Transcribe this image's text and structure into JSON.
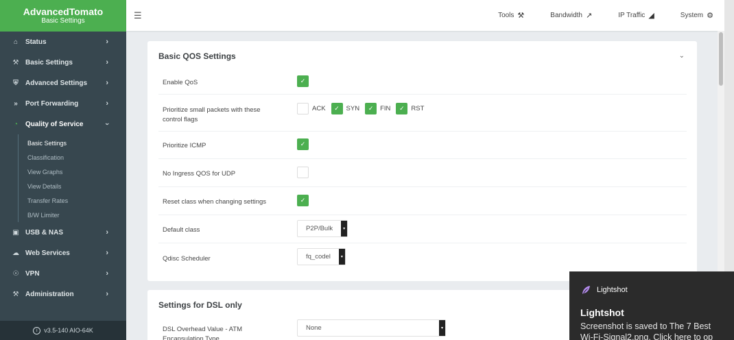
{
  "brand": {
    "title": "AdvancedTomato",
    "subtitle": "Basic Settings"
  },
  "sidebar": {
    "items": [
      {
        "label": "Status",
        "icon": "home-icon"
      },
      {
        "label": "Basic Settings",
        "icon": "wrench-icon"
      },
      {
        "label": "Advanced Settings",
        "icon": "shield-icon"
      },
      {
        "label": "Port Forwarding",
        "icon": "fast-forward-icon"
      },
      {
        "label": "Quality of Service",
        "icon": "gauge-icon"
      },
      {
        "label": "USB & NAS",
        "icon": "drive-icon"
      },
      {
        "label": "Web Services",
        "icon": "cloud-icon"
      },
      {
        "label": "VPN",
        "icon": "globe-icon"
      },
      {
        "label": "Administration",
        "icon": "wrench-icon"
      }
    ],
    "qos_subitems": [
      "Basic Settings",
      "Classification",
      "View Graphs",
      "View Details",
      "Transfer Rates",
      "B/W Limiter"
    ],
    "version": "v3.5-140 AIO-64K"
  },
  "topbar": {
    "items": [
      {
        "label": "Tools",
        "icon": "tools-icon"
      },
      {
        "label": "Bandwidth",
        "icon": "chart-line-icon"
      },
      {
        "label": "IP Traffic",
        "icon": "area-chart-icon"
      },
      {
        "label": "System",
        "icon": "gear-icon"
      }
    ]
  },
  "qos": {
    "title": "Basic QOS Settings",
    "enable_qos": {
      "label": "Enable QoS",
      "checked": true
    },
    "prioritize_flags": {
      "label": "Prioritize small packets with these control flags",
      "flags": [
        {
          "label": "ACK",
          "checked": false
        },
        {
          "label": "SYN",
          "checked": true
        },
        {
          "label": "FIN",
          "checked": true
        },
        {
          "label": "RST",
          "checked": true
        }
      ]
    },
    "prioritize_icmp": {
      "label": "Prioritize ICMP",
      "checked": true
    },
    "no_ingress_udp": {
      "label": "No Ingress QOS for UDP",
      "checked": false
    },
    "reset_class": {
      "label": "Reset class when changing settings",
      "checked": true
    },
    "default_class": {
      "label": "Default class",
      "value": "P2P/Bulk"
    },
    "qdisc": {
      "label": "Qdisc Scheduler",
      "value": "fq_codel"
    }
  },
  "dsl": {
    "title": "Settings for DSL only",
    "overhead": {
      "label": "DSL Overhead Value - ATM Encapsulation Type",
      "value": "None"
    }
  },
  "toast": {
    "app": "Lightshot",
    "title": "Lightshot",
    "line1": "Screenshot is saved to The 7 Best",
    "line2": "Wi-Fi-Signal2.png. Click here to op"
  },
  "colors": {
    "accent": "#4caf50",
    "sidebar": "#37474f"
  }
}
